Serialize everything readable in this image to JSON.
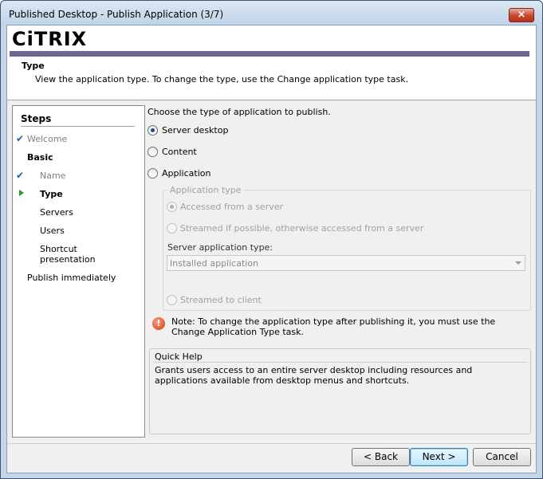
{
  "window": {
    "title": "Published Desktop - Publish Application (3/7)",
    "close_glyph": "×"
  },
  "header": {
    "logo_text": "CiTRIX",
    "page_title": "Type",
    "description": "View the application type.  To change the type, use the Change application type task."
  },
  "steps": {
    "title": "Steps",
    "items": [
      {
        "label": "Welcome",
        "state": "done"
      },
      {
        "label": "Basic",
        "state": "section"
      },
      {
        "label": "Name",
        "state": "done"
      },
      {
        "label": "Type",
        "state": "current"
      },
      {
        "label": "Servers",
        "state": "pending"
      },
      {
        "label": "Users",
        "state": "pending"
      },
      {
        "label": "Shortcut presentation",
        "state": "pending"
      },
      {
        "label": "Publish immediately",
        "state": "pending"
      }
    ]
  },
  "main": {
    "prompt": "Choose the type of application to publish.",
    "options": [
      {
        "label": "Server desktop",
        "selected": true
      },
      {
        "label": "Content",
        "selected": false
      },
      {
        "label": "Application",
        "selected": false
      }
    ],
    "app_type": {
      "legend": "Application type",
      "opt_accessed": "Accessed from a server",
      "opt_streamed_fallback": "Streamed if possible, otherwise accessed from a server",
      "server_type_label": "Server application type:",
      "server_type_value": "Installed application",
      "opt_streamed_client": "Streamed to client"
    },
    "note": "Note: To change the application type after publishing it, you must use the Change Application Type task.",
    "quick_help": {
      "title": "Quick Help",
      "body": "Grants users access to an entire server desktop including resources and applications available from desktop menus and shortcuts."
    }
  },
  "buttons": {
    "back": "< Back",
    "next": "Next >",
    "cancel": "Cancel"
  },
  "colors": {
    "accent_bar": "#6d6793",
    "check": "#1b5fb4",
    "current_arrow": "#2a9a2a",
    "warning": "#d53a0f"
  }
}
